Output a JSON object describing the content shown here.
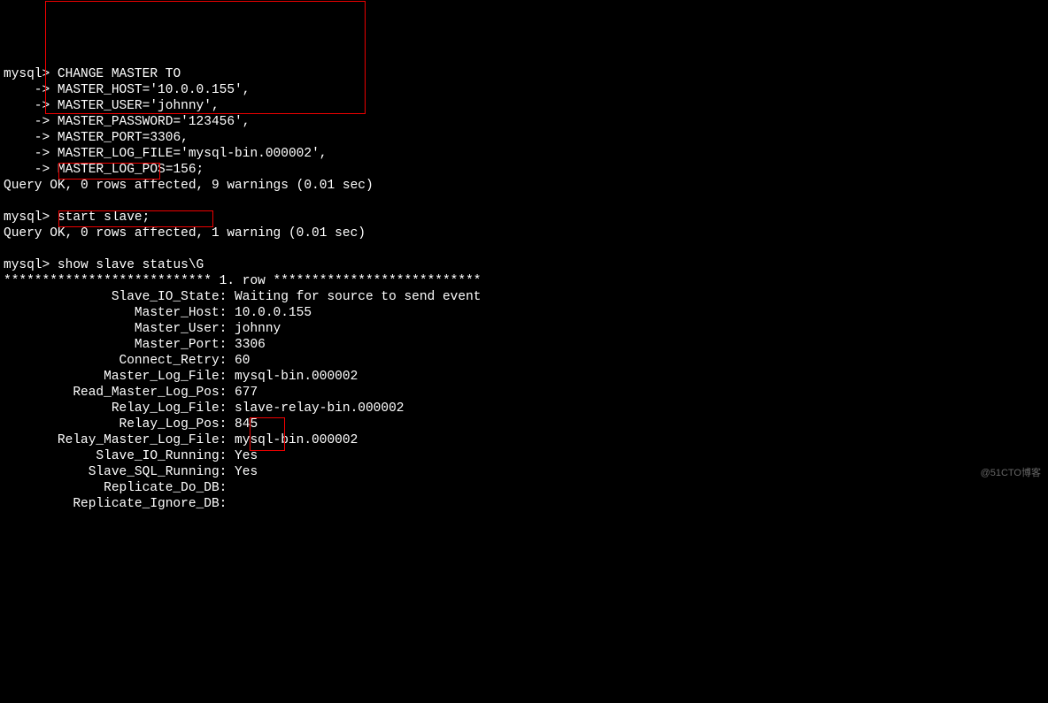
{
  "prompt": "mysql>",
  "cont": "    ->",
  "cmd": {
    "change_master": " CHANGE MASTER TO",
    "host": " MASTER_HOST='10.0.0.155',",
    "user": " MASTER_USER='johnny',",
    "password": " MASTER_PASSWORD='123456',",
    "port": " MASTER_PORT=3306,",
    "logfile": " MASTER_LOG_FILE='mysql-bin.000002',",
    "logpos": " MASTER_LOG_POS=156;",
    "start_slave": " start slave;",
    "show_status": " show slave status\\G"
  },
  "result": {
    "q1": "Query OK, 0 rows affected, 9 warnings (0.01 sec)",
    "q2": "Query OK, 0 rows affected, 1 warning (0.01 sec)"
  },
  "row_header": "*************************** 1. row ***************************",
  "status": {
    "labels": {
      "slave_io_state": "              Slave_IO_State:",
      "master_host": "                 Master_Host:",
      "master_user": "                 Master_User:",
      "master_port": "                 Master_Port:",
      "connect_retry": "               Connect_Retry:",
      "master_log_file": "             Master_Log_File:",
      "read_master_log_pos": "         Read_Master_Log_Pos:",
      "relay_log_file": "              Relay_Log_File:",
      "relay_log_pos": "               Relay_Log_Pos:",
      "relay_master_log_file": "       Relay_Master_Log_File:",
      "slave_io_running": "            Slave_IO_Running:",
      "slave_sql_running": "           Slave_SQL_Running:",
      "replicate_do_db": "             Replicate_Do_DB:",
      "replicate_ignore_db": "         Replicate_Ignore_DB:"
    },
    "values": {
      "slave_io_state": " Waiting for source to send event",
      "master_host": " 10.0.0.155",
      "master_user": " johnny",
      "master_port": " 3306",
      "connect_retry": " 60",
      "master_log_file": " mysql-bin.000002",
      "read_master_log_pos": " 677",
      "relay_log_file": " slave-relay-bin.000002",
      "relay_log_pos": " 845",
      "relay_master_log_file": " mysql-bin.000002",
      "slave_io_running": " Yes",
      "slave_sql_running": " Yes",
      "replicate_do_db": "",
      "replicate_ignore_db": ""
    }
  },
  "watermark": "@51CTO博客"
}
